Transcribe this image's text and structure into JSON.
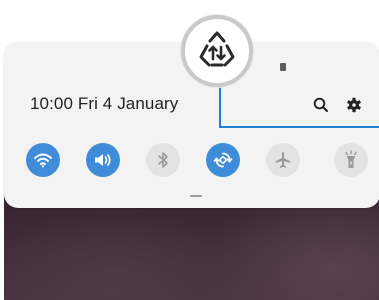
{
  "status_bar": {
    "datetime": "10:00  Fri 4 January"
  },
  "actions": [
    {
      "icon": "search-icon"
    },
    {
      "icon": "gear-icon"
    }
  ],
  "magnifier": {
    "icon": "recycle-share-icon"
  },
  "quick_settings": [
    {
      "icon": "wifi-icon",
      "state": "on"
    },
    {
      "icon": "sound-icon",
      "state": "on"
    },
    {
      "icon": "bluetooth-icon",
      "state": "off"
    },
    {
      "icon": "auto-rotate-icon",
      "state": "on"
    },
    {
      "icon": "airplane-mode-icon",
      "state": "off"
    },
    {
      "icon": "flashlight-icon",
      "state": "off"
    }
  ],
  "colors": {
    "accent": "#3f8cd8",
    "highlight": "#1c7fd8",
    "toggle_off": "#e3e3e3",
    "panel": "#f3f3f3"
  }
}
